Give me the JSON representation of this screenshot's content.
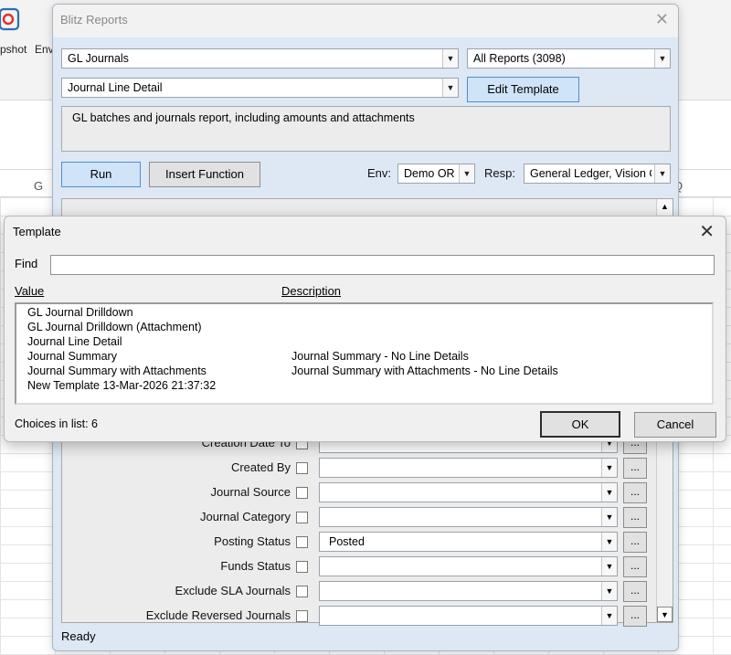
{
  "background": {
    "ribbon": {
      "snapshot_label": "pshot",
      "env_label": "Env"
    },
    "columns": [
      "G",
      "Q"
    ]
  },
  "blitz": {
    "title": "Blitz Reports",
    "report_combo": "GL Journals",
    "category_combo": "All Reports (3098)",
    "template_combo": "Journal Line Detail",
    "edit_template_label": "Edit Template",
    "description": "GL batches and journals report, including amounts and attachments",
    "run_label": "Run",
    "insert_function_label": "Insert Function",
    "env_label": "Env:",
    "env_value": "Demo OR",
    "resp_label": "Resp:",
    "resp_value": "General Ledger, Vision Op",
    "params": [
      {
        "label": "Creation Date To",
        "value": ""
      },
      {
        "label": "Created By",
        "value": ""
      },
      {
        "label": "Journal Source",
        "value": ""
      },
      {
        "label": "Journal Category",
        "value": ""
      },
      {
        "label": "Posting Status",
        "value": "Posted"
      },
      {
        "label": "Funds Status",
        "value": ""
      },
      {
        "label": "Exclude SLA Journals",
        "value": ""
      },
      {
        "label": "Exclude Reversed Journals",
        "value": ""
      }
    ],
    "dots_label": "...",
    "status": "Ready"
  },
  "template_dialog": {
    "title": "Template",
    "find_label": "Find",
    "find_value": "",
    "col_value": "Value",
    "col_description": "Description",
    "rows": [
      {
        "value": "GL Journal Drilldown",
        "description": ""
      },
      {
        "value": "GL Journal Drilldown (Attachment)",
        "description": ""
      },
      {
        "value": "Journal Line Detail",
        "description": ""
      },
      {
        "value": "Journal Summary",
        "description": "Journal Summary - No Line Details"
      },
      {
        "value": "Journal Summary with Attachments",
        "description": "Journal Summary with Attachments - No Line Details"
      },
      {
        "value": "New Template 13-Mar-2026 21:37:32",
        "description": ""
      }
    ],
    "choices_text": "Choices in list: 6",
    "ok_label": "OK",
    "cancel_label": "Cancel"
  },
  "colors": {
    "button_blue": "#cfe4f8",
    "window_bg": "#dde8f4",
    "dialog_bg": "#f0f0f0"
  }
}
